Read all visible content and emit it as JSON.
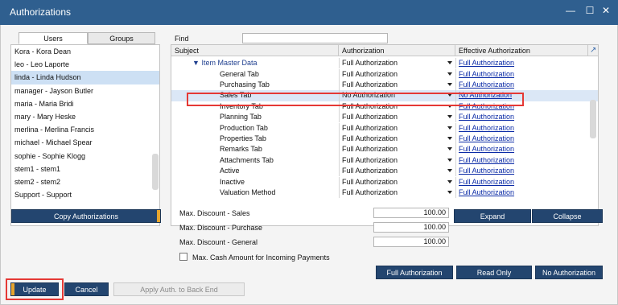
{
  "window": {
    "title": "Authorizations"
  },
  "title_controls": {
    "minimize": "—",
    "maximize": "☐",
    "close": "✕"
  },
  "tabs": [
    {
      "label": "Users"
    },
    {
      "label": "Groups"
    }
  ],
  "users": [
    "Kora - Kora Dean",
    "leo - Leo Laporte",
    "linda - Linda Hudson",
    "manager - Jayson Butler",
    "maria - Maria Bridi",
    "mary - Mary Heske",
    "merlina - Merlina Francis",
    "michael - Michael Spear",
    "sophie - Sophie Klogg",
    "stem1 - stem1",
    "stem2 - stem2",
    "Support - Support"
  ],
  "selected_user_index": 2,
  "find": {
    "label": "Find",
    "value": ""
  },
  "grid": {
    "headers": [
      "Subject",
      "Authorization",
      "Effective Authorization"
    ],
    "group_row": {
      "subject": "Item Master Data",
      "authorization": "Full Authorization",
      "effective": "Full Authorization"
    },
    "rows": [
      {
        "subject": "General Tab",
        "authorization": "Full Authorization",
        "effective": "Full Authorization"
      },
      {
        "subject": "Purchasing Tab",
        "authorization": "Full Authorization",
        "effective": "Full Authorization"
      },
      {
        "subject": "Sales Tab",
        "authorization": "No Authorization",
        "effective": "No Authorization"
      },
      {
        "subject": "Inventory Tab",
        "authorization": "Full Authorization",
        "effective": "Full Authorization"
      },
      {
        "subject": "Planning Tab",
        "authorization": "Full Authorization",
        "effective": "Full Authorization"
      },
      {
        "subject": "Production Tab",
        "authorization": "Full Authorization",
        "effective": "Full Authorization"
      },
      {
        "subject": "Properties Tab",
        "authorization": "Full Authorization",
        "effective": "Full Authorization"
      },
      {
        "subject": "Remarks Tab",
        "authorization": "Full Authorization",
        "effective": "Full Authorization"
      },
      {
        "subject": "Attachments Tab",
        "authorization": "Full Authorization",
        "effective": "Full Authorization"
      },
      {
        "subject": "Active",
        "authorization": "Full Authorization",
        "effective": "Full Authorization"
      },
      {
        "subject": "Inactive",
        "authorization": "Full Authorization",
        "effective": "Full Authorization"
      },
      {
        "subject": "Valuation Method",
        "authorization": "Full Authorization",
        "effective": "Full Authorization"
      }
    ],
    "highlighted_row_index": 2
  },
  "copy_button": "Copy Authorizations",
  "expand_button": "Expand",
  "collapse_button": "Collapse",
  "discounts": [
    {
      "label": "Max. Discount - Sales",
      "value": "100.00"
    },
    {
      "label": "Max. Discount - Purchase",
      "value": "100.00"
    },
    {
      "label": "Max. Discount - General",
      "value": "100.00"
    }
  ],
  "cash_checkbox": {
    "label": "Max. Cash Amount for Incoming Payments",
    "checked": false
  },
  "auth_buttons": {
    "full": "Full Authorization",
    "read_only": "Read Only",
    "none": "No Authorization"
  },
  "footer": {
    "update": "Update",
    "cancel": "Cancel",
    "apply": "Apply Auth. to Back End"
  },
  "watermark": "STEM"
}
